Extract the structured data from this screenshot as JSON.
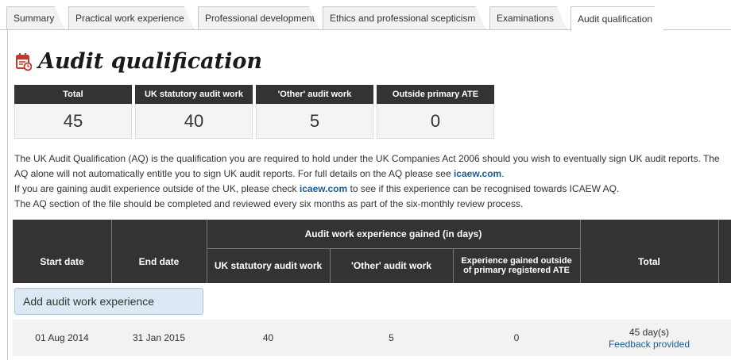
{
  "tabs": [
    {
      "label": "Summary"
    },
    {
      "label": "Practical work experience"
    },
    {
      "label": "Professional development"
    },
    {
      "label": "Ethics and professional scepticism"
    },
    {
      "label": "Examinations"
    },
    {
      "label": "Audit qualification",
      "active": true
    }
  ],
  "page": {
    "title": "Audit qualification",
    "icon": "calendar-clock-icon"
  },
  "summary": [
    {
      "label": "Total",
      "value": "45"
    },
    {
      "label": "UK statutory audit work",
      "value": "40"
    },
    {
      "label": "'Other' audit work",
      "value": "5"
    },
    {
      "label": "Outside primary ATE",
      "value": "0"
    }
  ],
  "description": {
    "p1_before": "The UK Audit Qualification (AQ) is the qualification you are required to hold under the UK Companies Act 2006 should you wish to eventually sign UK audit reports. The AQ alone will not automatically entitle you to sign UK audit reports. For full details on the AQ please see ",
    "p1_link": "icaew.com",
    "p1_after": ".",
    "p2_before": "If you are gaining audit experience outside of the UK, please check ",
    "p2_link": "icaew.com",
    "p2_after": " to see if this experience can be recognised towards ICAEW AQ.",
    "p3": "The AQ section of the file should be completed and reviewed every six months as part of the six-monthly review process."
  },
  "table": {
    "group_header": "Audit work experience gained (in days)",
    "columns": {
      "start": "Start date",
      "end": "End date",
      "uk": "UK statutory audit work",
      "other": "'Other' audit work",
      "outside": "Experience gained outside of primary registered ATE",
      "total": "Total"
    },
    "add_button": "Add audit work experience",
    "rows": [
      {
        "start": "01 Aug 2014",
        "end": "31 Jan 2015",
        "uk": "40",
        "other": "5",
        "outside": "0",
        "total": "45 day(s)",
        "status_link": "Feedback provided"
      }
    ]
  },
  "colors": {
    "header_bg": "#333333",
    "link": "#1a5e94",
    "button_bg": "#dce9f4",
    "icon_red": "#c0392b"
  }
}
